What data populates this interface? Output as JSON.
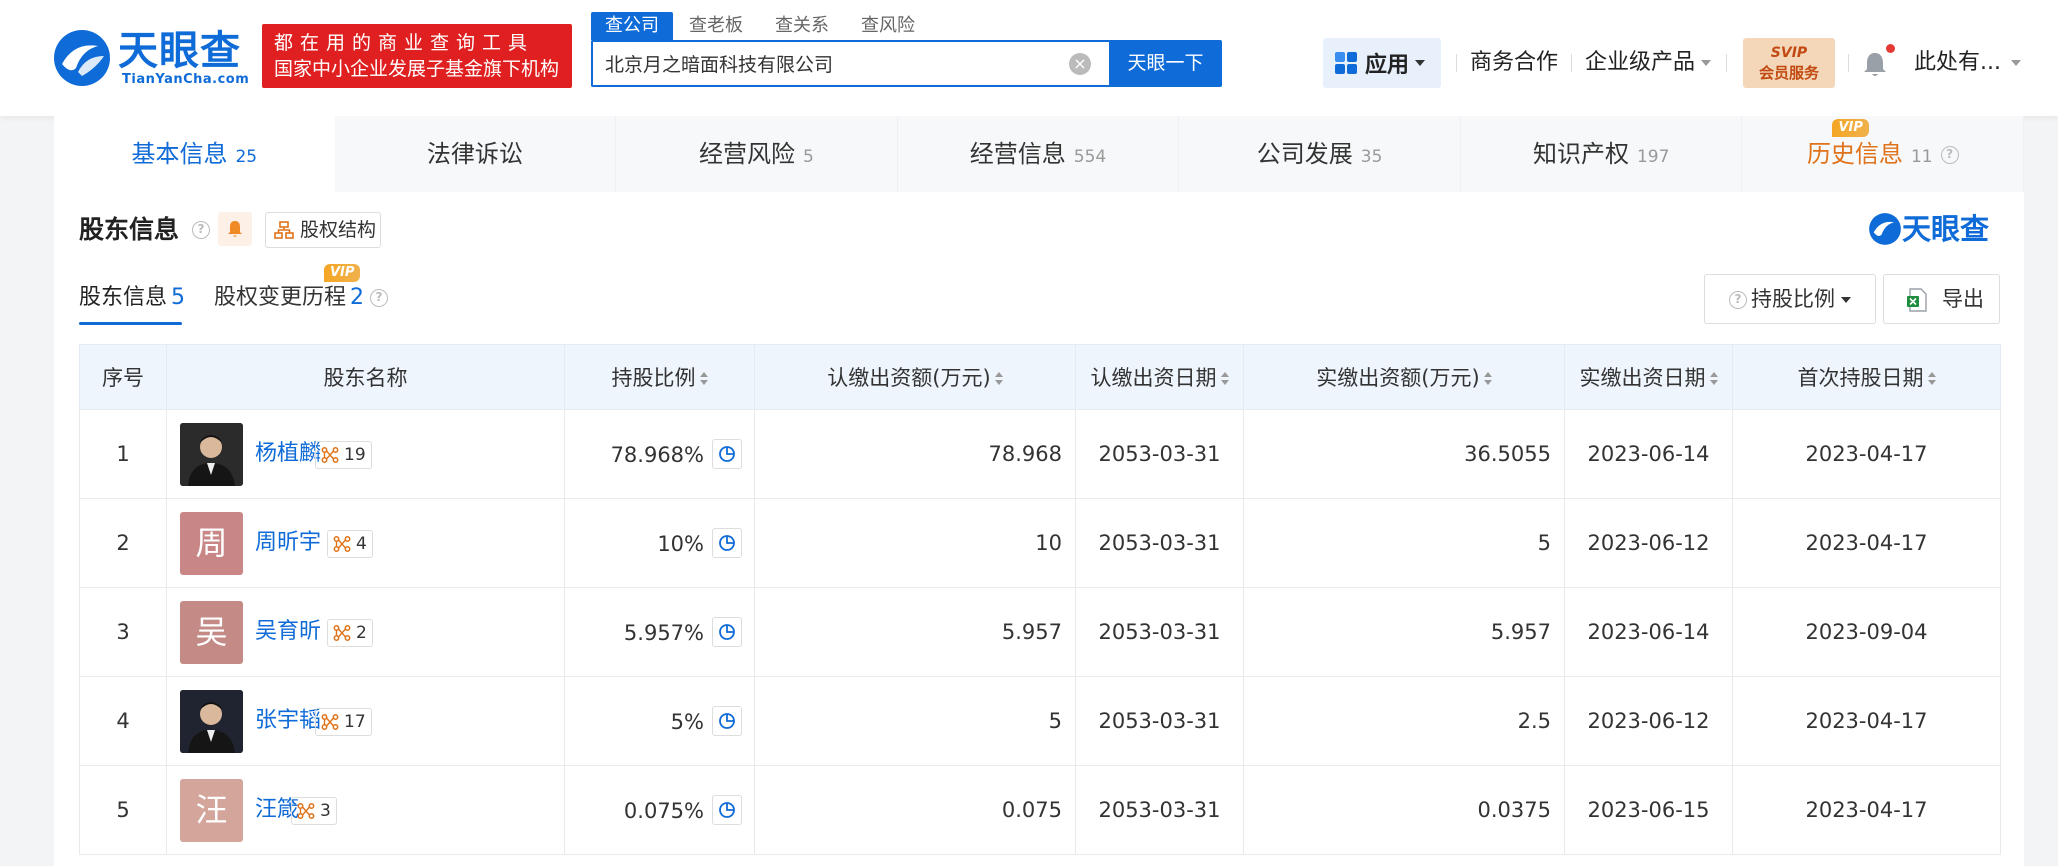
{
  "header": {
    "logo_cn": "天眼查",
    "logo_en": "TianYanCha.com",
    "slogan_line1": "都在用的商业查询工具",
    "slogan_line2": "国家中小企业发展子基金旗下机构",
    "search_tabs": [
      "查公司",
      "查老板",
      "查关系",
      "查风险"
    ],
    "search_value": "北京月之暗面科技有限公司",
    "search_button": "天眼一下",
    "nav_app": "应用",
    "nav_business": "商务合作",
    "nav_enterprise": "企业级产品",
    "vip_line1": "SVIP",
    "vip_line2": "会员服务",
    "user_name": "此处有..."
  },
  "tabs": [
    {
      "label": "基本信息",
      "count": "25"
    },
    {
      "label": "法律诉讼",
      "count": ""
    },
    {
      "label": "经营风险",
      "count": "5"
    },
    {
      "label": "经营信息",
      "count": "554"
    },
    {
      "label": "公司发展",
      "count": "35"
    },
    {
      "label": "知识产权",
      "count": "197"
    },
    {
      "label": "历史信息",
      "count": "11",
      "tag": "VIP"
    }
  ],
  "section": {
    "title": "股东信息",
    "structure_button": "股权结构",
    "brand": "天眼查",
    "subtab1_label": "股东信息",
    "subtab1_count": "5",
    "subtab2_label": "股权变更历程",
    "subtab2_count": "2",
    "subtab2_tag": "VIP",
    "ratio_button": "持股比例",
    "export_button": "导出"
  },
  "table": {
    "headers": [
      "序号",
      "股东名称",
      "持股比例",
      "认缴出资额(万元)",
      "认缴出资日期",
      "实缴出资额(万元)",
      "实缴出资日期",
      "首次持股日期"
    ],
    "rows": [
      {
        "no": "1",
        "avatar": "",
        "name": "杨植麟",
        "rel": "19",
        "ratio": "78.968%",
        "sub_amount": "78.968",
        "sub_date": "2053-03-31",
        "paid_amount": "36.5055",
        "paid_date": "2023-06-14",
        "first_date": "2023-04-17"
      },
      {
        "no": "2",
        "avatar": "周",
        "name": "周昕宇",
        "rel": "4",
        "ratio": "10%",
        "sub_amount": "10",
        "sub_date": "2053-03-31",
        "paid_amount": "5",
        "paid_date": "2023-06-12",
        "first_date": "2023-04-17"
      },
      {
        "no": "3",
        "avatar": "吴",
        "name": "吴育昕",
        "rel": "2",
        "ratio": "5.957%",
        "sub_amount": "5.957",
        "sub_date": "2053-03-31",
        "paid_amount": "5.957",
        "paid_date": "2023-06-14",
        "first_date": "2023-09-04"
      },
      {
        "no": "4",
        "avatar": "",
        "name": "张宇韬",
        "rel": "17",
        "ratio": "5%",
        "sub_amount": "5",
        "sub_date": "2053-03-31",
        "paid_amount": "2.5",
        "paid_date": "2023-06-12",
        "first_date": "2023-04-17"
      },
      {
        "no": "5",
        "avatar": "汪",
        "name": "汪箴",
        "rel": "3",
        "ratio": "0.075%",
        "sub_amount": "0.075",
        "sub_date": "2053-03-31",
        "paid_amount": "0.0375",
        "paid_date": "2023-06-15",
        "first_date": "2023-04-17"
      }
    ]
  },
  "colors": {
    "brand_blue": "#0f6bd7",
    "slogan_red": "#e02020",
    "vip_orange": "#e0731a",
    "avatar_colors": [
      "#2b2b2b",
      "#c98686",
      "#c48a86",
      "#1f2430",
      "#d4a59a"
    ]
  }
}
